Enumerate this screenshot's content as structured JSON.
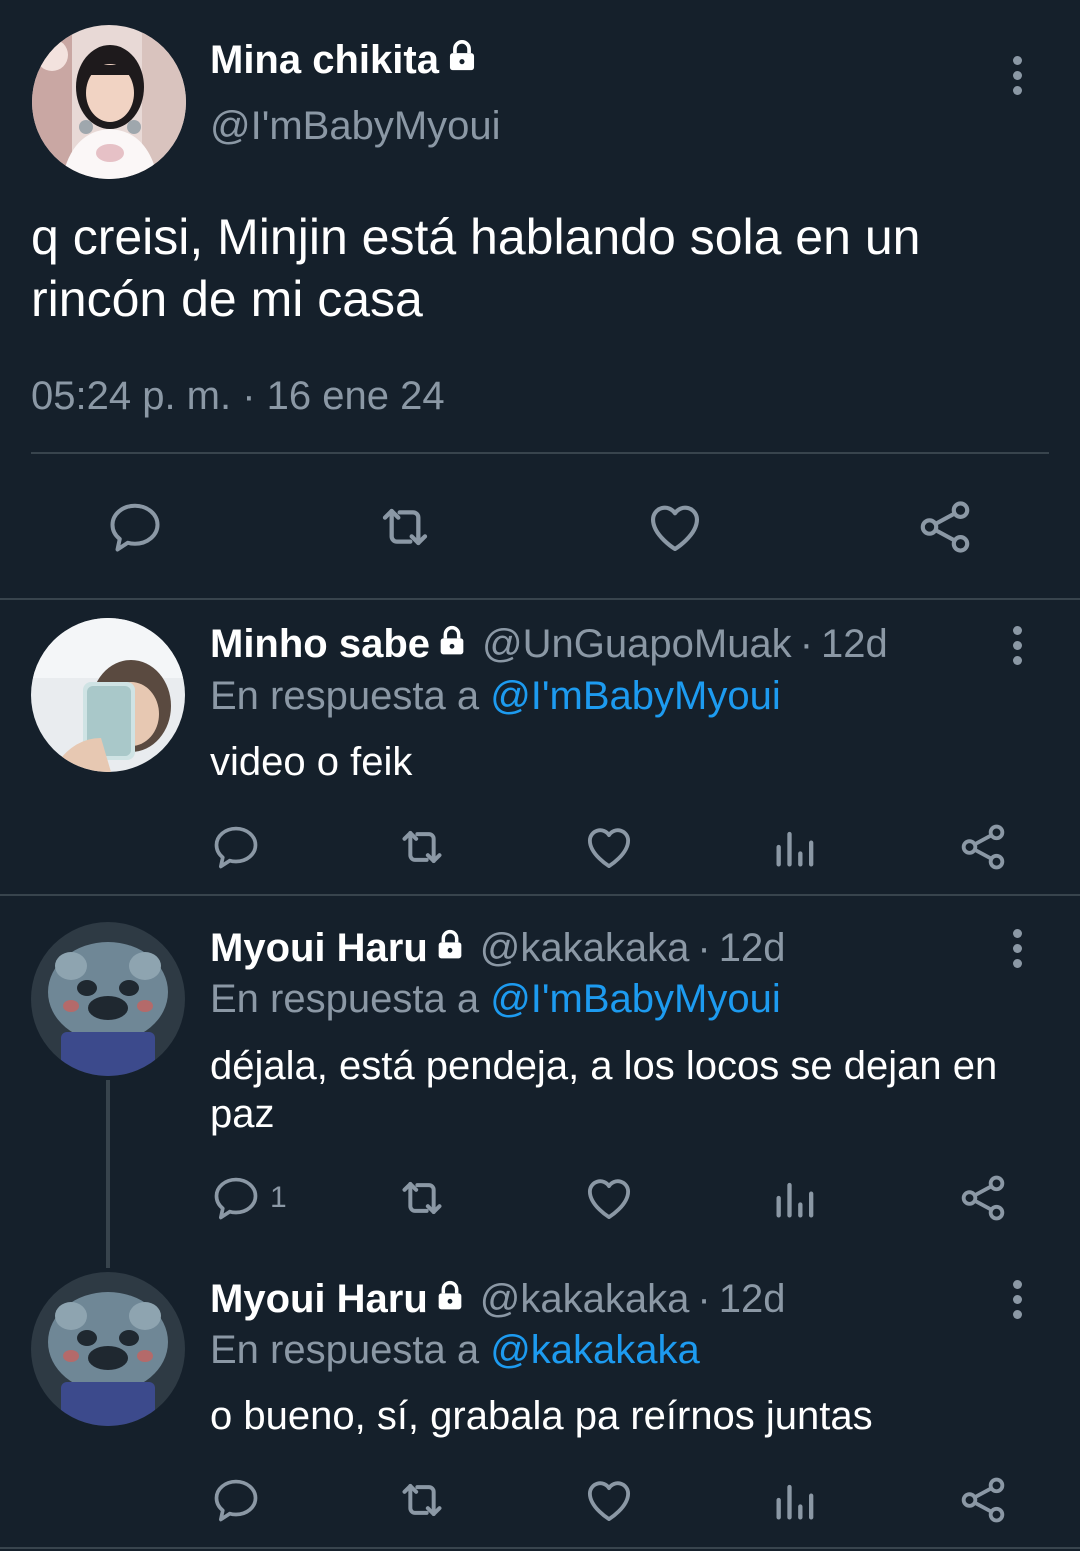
{
  "main_tweet": {
    "author_name": "Mina chikita",
    "handle": "@I'mBabyMyoui",
    "text": "q creisi, Minjin está hablando sola en un rincón de mi casa",
    "timestamp": "05:24 p. m. · 16 ene 24",
    "protected": true,
    "actions": [
      "reply-icon",
      "retweet-icon",
      "like-icon",
      "share-icon"
    ]
  },
  "replies": [
    {
      "author_name": "Minho sabe",
      "handle": "@UnGuapoMuak",
      "separator": "·",
      "time": "12d",
      "reply_prefix": "En respuesta a",
      "reply_to": "@I'mBabyMyoui",
      "text": "video o feik",
      "reply_count": ""
    },
    {
      "author_name": "Myoui Haru",
      "handle": "@kakakaka",
      "separator": "·",
      "time": "12d",
      "reply_prefix": "En respuesta a",
      "reply_to": "@I'mBabyMyoui",
      "text": "déjala, está pendeja, a los locos se dejan en paz",
      "reply_count": "1"
    },
    {
      "author_name": "Myoui Haru",
      "handle": "@kakakaka",
      "separator": "·",
      "time": "12d",
      "reply_prefix": "En respuesta a",
      "reply_to": "@kakakaka",
      "text": "o bueno, sí, grabala pa reírnos juntas",
      "reply_count": ""
    }
  ],
  "colors": {
    "background": "#15202b",
    "text_primary": "#ffffff",
    "text_secondary": "#8b98a5",
    "link": "#1d9bf0",
    "divider": "#38444d"
  }
}
